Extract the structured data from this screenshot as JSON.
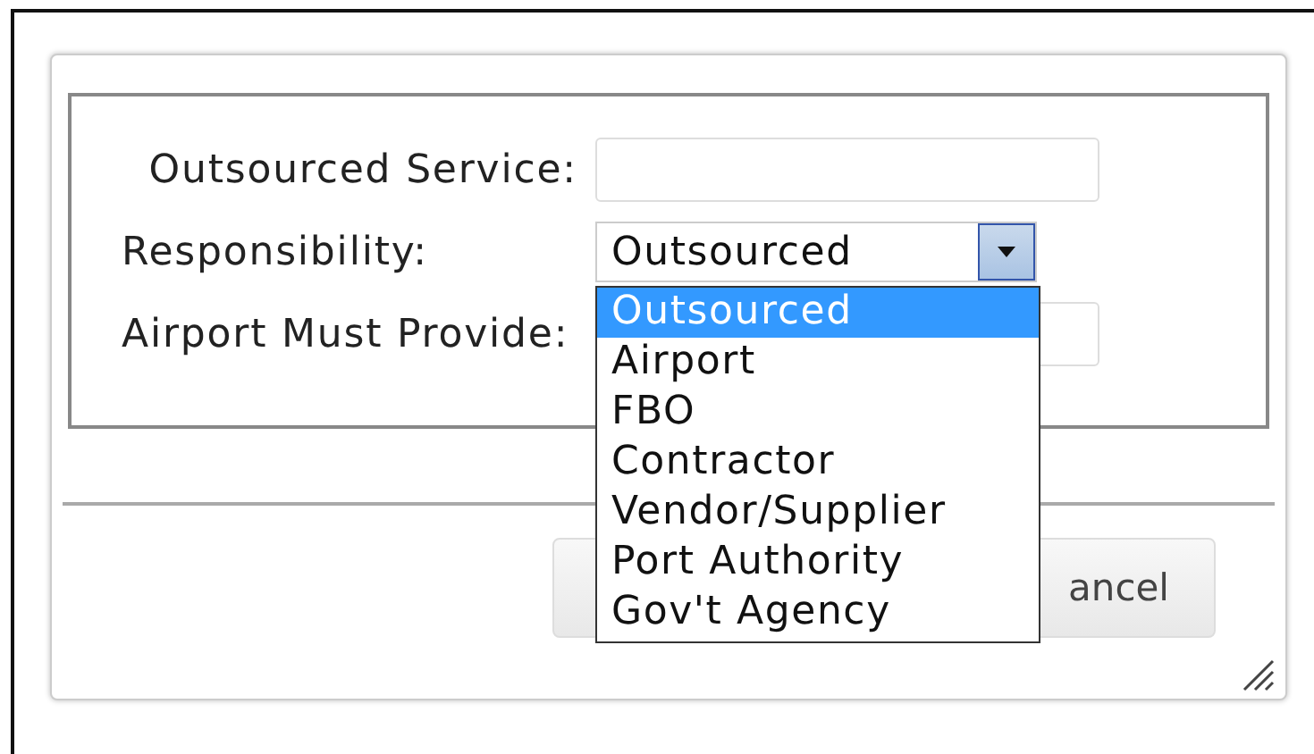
{
  "dialog": {
    "fields": [
      {
        "kind": "text",
        "label": "Outsourced Service:"
      },
      {
        "kind": "select",
        "label": "Responsibility:",
        "value": "Outsourced",
        "expanded": true,
        "options": [
          {
            "label": "Outsourced",
            "selected": true
          },
          {
            "label": "Airport",
            "selected": false
          },
          {
            "label": "FBO",
            "selected": false
          },
          {
            "label": "Contractor",
            "selected": false
          },
          {
            "label": "Vendor/Supplier",
            "selected": false
          },
          {
            "label": "Port Authority",
            "selected": false
          },
          {
            "label": "Gov't Agency",
            "selected": false
          }
        ]
      },
      {
        "kind": "text",
        "label": "Airport Must Provide:"
      }
    ],
    "cancel_button": {
      "label": "ancel"
    }
  }
}
